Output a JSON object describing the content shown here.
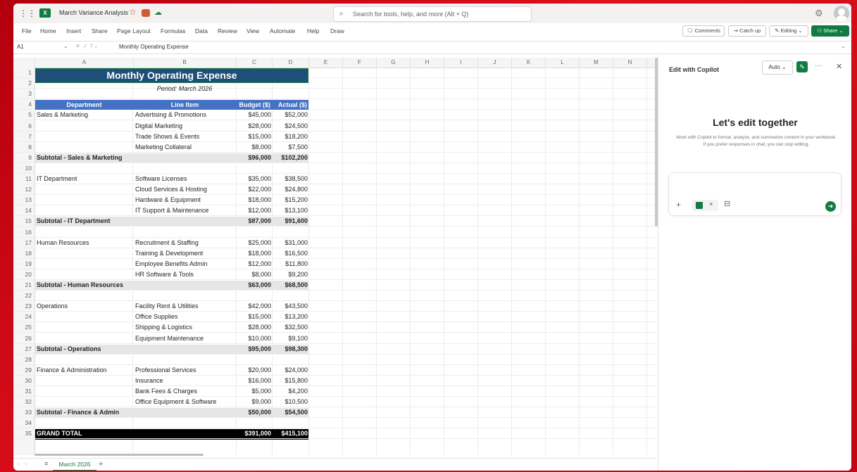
{
  "app": {
    "doc_title": "March Variance Analysis",
    "search_placeholder": "Search for tools, help, and more (Alt + Q)"
  },
  "menu": [
    "File",
    "Home",
    "Insert",
    "Share",
    "Page Layout",
    "Formulas",
    "Data",
    "Review",
    "View",
    "Automate",
    "Help",
    "Draw"
  ],
  "menu_buttons": {
    "comments": "Comments",
    "catchup": "Catch up",
    "editing": "Editing",
    "share": "Share"
  },
  "formula_bar": {
    "name_box": "A1",
    "content": "Monthly Operating Expense"
  },
  "columns": [
    "A",
    "B",
    "C",
    "D",
    "E",
    "F",
    "G",
    "H",
    "I",
    "J",
    "K",
    "L",
    "M",
    "N"
  ],
  "sheet": {
    "title": "Monthly Operating Expense",
    "period": "Period: March 2026",
    "headers": [
      "Department",
      "Line Item",
      "Budget ($)",
      "Actual ($)"
    ],
    "rows": [
      {
        "n": "5",
        "a": "Sales & Marketing",
        "b": "Advertising & Promotions",
        "c": "$45,000",
        "d": "$52,000"
      },
      {
        "n": "6",
        "a": "",
        "b": "Digital Marketing",
        "c": "$28,000",
        "d": "$24,500"
      },
      {
        "n": "7",
        "a": "",
        "b": "Trade Shows & Events",
        "c": "$15,000",
        "d": "$18,200"
      },
      {
        "n": "8",
        "a": "",
        "b": "Marketing Collateral",
        "c": "$8,000",
        "d": "$7,500"
      },
      {
        "n": "9",
        "a": "Subtotal - Sales & Marketing",
        "b": "",
        "c": "$96,000",
        "d": "$102,200",
        "type": "sub"
      },
      {
        "n": "10",
        "a": "",
        "b": "",
        "c": "",
        "d": ""
      },
      {
        "n": "11",
        "a": "IT Department",
        "b": "Software Licenses",
        "c": "$35,000",
        "d": "$38,500"
      },
      {
        "n": "12",
        "a": "",
        "b": "Cloud Services & Hosting",
        "c": "$22,000",
        "d": "$24,800"
      },
      {
        "n": "13",
        "a": "",
        "b": "Hardware & Equipment",
        "c": "$18,000",
        "d": "$15,200"
      },
      {
        "n": "14",
        "a": "",
        "b": "IT Support & Maintenance",
        "c": "$12,000",
        "d": "$13,100"
      },
      {
        "n": "15",
        "a": "Subtotal - IT Department",
        "b": "",
        "c": "$87,000",
        "d": "$91,600",
        "type": "sub"
      },
      {
        "n": "16",
        "a": "",
        "b": "",
        "c": "",
        "d": ""
      },
      {
        "n": "17",
        "a": "Human Resources",
        "b": "Recruitment & Staffing",
        "c": "$25,000",
        "d": "$31,000"
      },
      {
        "n": "18",
        "a": "",
        "b": "Training & Development",
        "c": "$18,000",
        "d": "$16,500"
      },
      {
        "n": "19",
        "a": "",
        "b": "Employee Benefits Admin",
        "c": "$12,000",
        "d": "$11,800"
      },
      {
        "n": "20",
        "a": "",
        "b": "HR Software & Tools",
        "c": "$8,000",
        "d": "$9,200"
      },
      {
        "n": "21",
        "a": "Subtotal - Human Resources",
        "b": "",
        "c": "$63,000",
        "d": "$68,500",
        "type": "sub"
      },
      {
        "n": "22",
        "a": "",
        "b": "",
        "c": "",
        "d": ""
      },
      {
        "n": "23",
        "a": "Operations",
        "b": "Facility Rent & Utilities",
        "c": "$42,000",
        "d": "$43,500"
      },
      {
        "n": "24",
        "a": "",
        "b": "Office Supplies",
        "c": "$15,000",
        "d": "$13,200"
      },
      {
        "n": "25",
        "a": "",
        "b": "Shipping & Logistics",
        "c": "$28,000",
        "d": "$32,500"
      },
      {
        "n": "26",
        "a": "",
        "b": "Equipment Maintenance",
        "c": "$10,000",
        "d": "$9,100"
      },
      {
        "n": "27",
        "a": "Subtotal - Operations",
        "b": "",
        "c": "$95,000",
        "d": "$98,300",
        "type": "sub"
      },
      {
        "n": "28",
        "a": "",
        "b": "",
        "c": "",
        "d": ""
      },
      {
        "n": "29",
        "a": "Finance & Administration",
        "b": "Professional Services",
        "c": "$20,000",
        "d": "$24,000"
      },
      {
        "n": "30",
        "a": "",
        "b": "Insurance",
        "c": "$16,000",
        "d": "$15,800"
      },
      {
        "n": "31",
        "a": "",
        "b": "Bank Fees & Charges",
        "c": "$5,000",
        "d": "$4,200"
      },
      {
        "n": "32",
        "a": "",
        "b": "Office Equipment & Software",
        "c": "$9,000",
        "d": "$10,500"
      },
      {
        "n": "33",
        "a": "Subtotal - Finance & Admin",
        "b": "",
        "c": "$50,000",
        "d": "$54,500",
        "type": "sub"
      },
      {
        "n": "34",
        "a": "",
        "b": "",
        "c": "",
        "d": ""
      },
      {
        "n": "35",
        "a": "GRAND TOTAL",
        "b": "",
        "c": "$391,000",
        "d": "$415,100",
        "type": "grand"
      }
    ]
  },
  "sheet_tab": "March 2026",
  "copilot": {
    "title": "Edit with Copilot",
    "mode": "Auto",
    "headline": "Let's edit together",
    "description": "Work with Copilot to format, analyze, and summarize content in your workbook. If you prefer responses in chat, you can stop editing."
  },
  "colors": {
    "title_fill": "#1f4e79",
    "header_fill": "#4472c4",
    "subtotal_fill": "#e7e6e6",
    "grand_fill": "#000000",
    "excel_green": "#107c41"
  }
}
